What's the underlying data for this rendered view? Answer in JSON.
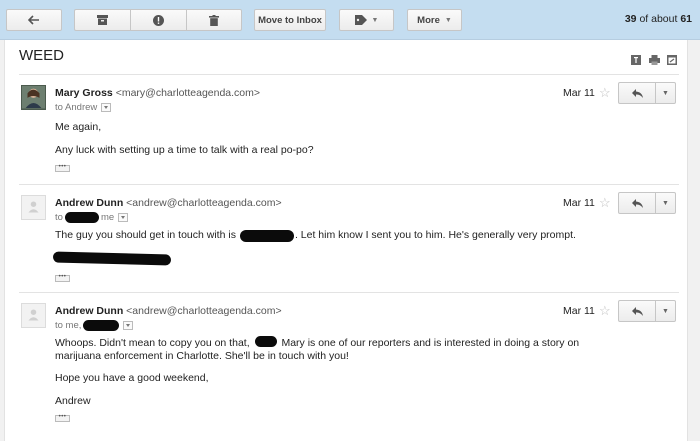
{
  "toolbar": {
    "back_icon": "back-arrow-icon",
    "archive_icon": "archive-icon",
    "spam_icon": "report-spam-icon",
    "delete_icon": "trash-icon",
    "move_label": "Move to Inbox",
    "labels_icon": "label-tag-icon",
    "more_label": "More",
    "counter_current": "39",
    "counter_mid": "of about",
    "counter_total": "61"
  },
  "thread": {
    "subject": "WEED",
    "subject_icons": [
      "expand-all-icon",
      "print-icon",
      "new-window-icon"
    ]
  },
  "messages": [
    {
      "sender_name": "Mary Gross",
      "sender_email": "<mary@charlotteagenda.com>",
      "to_prefix": "to Andrew",
      "date": "Mar 11",
      "body": [
        "Me again,",
        "Any luck with setting up a time to talk with a real po-po?"
      ]
    },
    {
      "sender_name": "Andrew Dunn",
      "sender_email": "<andrew@charlotteagenda.com>",
      "to_prefix": "to",
      "to_suffix": "me",
      "date": "Mar 11",
      "body_a": "The guy you should get in touch with is",
      "body_b": ". Let him know I sent you to him. He's generally very prompt."
    },
    {
      "sender_name": "Andrew Dunn",
      "sender_email": "<andrew@charlotteagenda.com>",
      "to_prefix": "to me,",
      "date": "Mar 11",
      "body_a": "Whoops. Didn't mean to copy you on that,",
      "body_b": "Mary is one of our reporters and is interested in doing a story on marijuana enforcement in Charlotte. She'll be in touch with you!",
      "body_c": "Hope you have a good weekend,",
      "body_d": "Andrew"
    }
  ],
  "colors": {
    "toolbar_bg": "#c4ddf0",
    "redaction": "#0b0b0b"
  }
}
